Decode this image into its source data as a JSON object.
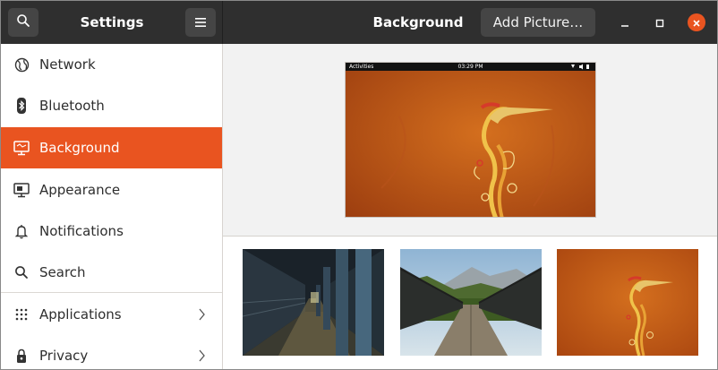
{
  "header": {
    "settings_title": "Settings",
    "panel_title": "Background",
    "add_picture_label": "Add Picture…"
  },
  "sidebar": {
    "items": [
      {
        "label": "Network",
        "icon": "network-icon"
      },
      {
        "label": "Bluetooth",
        "icon": "bluetooth-icon"
      },
      {
        "label": "Background",
        "icon": "background-icon",
        "active": true
      },
      {
        "label": "Appearance",
        "icon": "appearance-icon"
      },
      {
        "label": "Notifications",
        "icon": "bell-icon"
      },
      {
        "label": "Search",
        "icon": "search-icon"
      },
      {
        "label": "Applications",
        "icon": "apps-grid-icon",
        "has_submenu": true
      },
      {
        "label": "Privacy",
        "icon": "lock-icon",
        "has_submenu": true
      }
    ]
  },
  "preview": {
    "topbar_activities": "Activities",
    "topbar_time": "03:29 PM",
    "topbar_indicators": "▾ ◂) ▮"
  },
  "colors": {
    "accent": "#e95420",
    "header_bg": "#2f2f2f",
    "wallpaper": "#c45d15"
  },
  "gallery": [
    {
      "name": "subway-platform-thumbnail"
    },
    {
      "name": "bridge-mountain-thumbnail"
    },
    {
      "name": "ubuntu-heron-wallpaper-thumbnail"
    }
  ]
}
